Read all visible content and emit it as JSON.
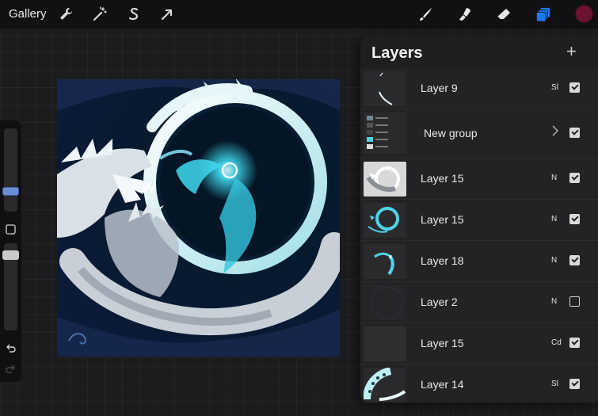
{
  "topbar": {
    "gallery_label": "Gallery",
    "left_tools": [
      {
        "icon": "wrench-icon"
      },
      {
        "icon": "magic-wand-icon"
      },
      {
        "icon": "selection-s-icon"
      },
      {
        "icon": "transform-arrow-icon"
      }
    ],
    "right_tools": [
      {
        "icon": "brush-icon"
      },
      {
        "icon": "smudge-icon"
      },
      {
        "icon": "eraser-icon"
      },
      {
        "icon": "layers-icon"
      }
    ],
    "current_color": "#6b1232",
    "accent_color": "#1a7cf5"
  },
  "sidebar": {
    "undo_icon": "undo-icon",
    "redo_icon": "redo-icon",
    "modify_icon": "modify-square-icon"
  },
  "layers_panel": {
    "title": "Layers",
    "add_icon": "plus-icon",
    "rows": [
      {
        "name": "Layer 9",
        "blend": "Sl",
        "visible": true,
        "thumb": "crescent-light"
      },
      {
        "name": "New group",
        "blend": "",
        "visible": true,
        "thumb": "group",
        "is_group": true
      },
      {
        "name": "Layer 15",
        "blend": "N",
        "visible": true,
        "thumb": "white-dragon"
      },
      {
        "name": "Layer 15",
        "blend": "N",
        "visible": true,
        "thumb": "cyan-ring"
      },
      {
        "name": "Layer 18",
        "blend": "N",
        "visible": true,
        "thumb": "cyan-wisps"
      },
      {
        "name": "Layer 2",
        "blend": "N",
        "visible": false,
        "thumb": "dark"
      },
      {
        "name": "Layer 15",
        "blend": "Cd",
        "visible": true,
        "thumb": "empty"
      },
      {
        "name": "Layer 14",
        "blend": "Sl",
        "visible": true,
        "thumb": "dotted-crescent"
      }
    ]
  }
}
